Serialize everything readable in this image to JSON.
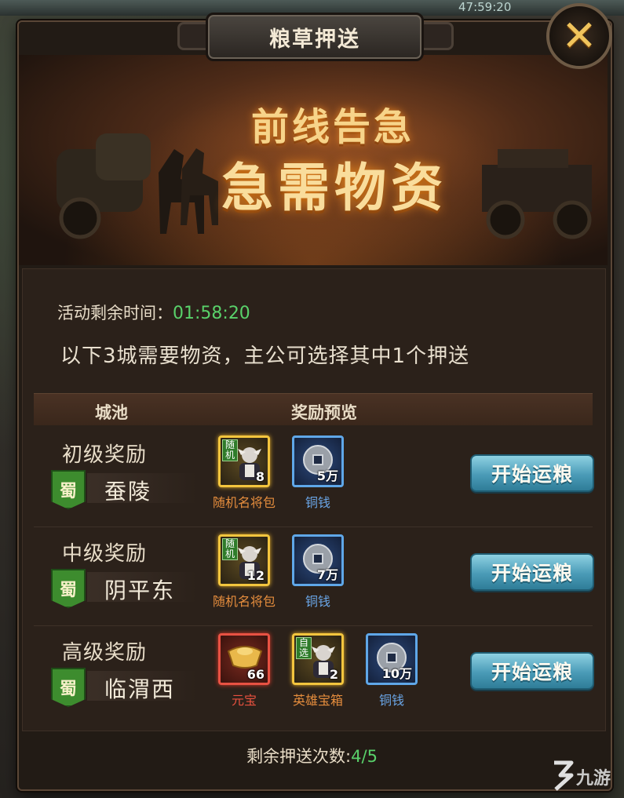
{
  "top_strip": {
    "time": "47:59:20"
  },
  "title": "粮草押送",
  "close_icon": "close-icon",
  "banner": {
    "line1": "前线告急",
    "line2": "急需物资"
  },
  "timer": {
    "label": "活动剩余时间：",
    "value": "01:58:20"
  },
  "description": "以下3城需要物资，主公可选择其中1个押送",
  "table_headers": {
    "city": "城池",
    "rewards": "奖励预览"
  },
  "rows": [
    {
      "level": "初级奖励",
      "faction": "蜀",
      "city": "蚕陵",
      "items": [
        {
          "label": "随机名将包",
          "count": "8",
          "tag": "随机",
          "style": "gold",
          "icon": "hero-card-icon"
        },
        {
          "label": "铜钱",
          "count": "5万",
          "style": "blue",
          "icon": "coin-icon"
        }
      ],
      "button": "开始运粮"
    },
    {
      "level": "中级奖励",
      "faction": "蜀",
      "city": "阴平东",
      "items": [
        {
          "label": "随机名将包",
          "count": "12",
          "tag": "随机",
          "style": "gold",
          "icon": "hero-card-icon"
        },
        {
          "label": "铜钱",
          "count": "7万",
          "style": "blue",
          "icon": "coin-icon"
        }
      ],
      "button": "开始运粮"
    },
    {
      "level": "高级奖励",
      "faction": "蜀",
      "city": "临渭西",
      "items": [
        {
          "label": "元宝",
          "count": "66",
          "style": "red",
          "icon": "gold-ingot-icon"
        },
        {
          "label": "英雄宝箱",
          "count": "2",
          "tag": "自选",
          "style": "gold",
          "icon": "hero-card-icon"
        },
        {
          "label": "铜钱",
          "count": "10万",
          "style": "blue",
          "icon": "coin-icon"
        }
      ],
      "button": "开始运粮"
    }
  ],
  "remaining": {
    "label": "剩余押送次数:",
    "value": "4/5"
  },
  "watermark": "九游"
}
